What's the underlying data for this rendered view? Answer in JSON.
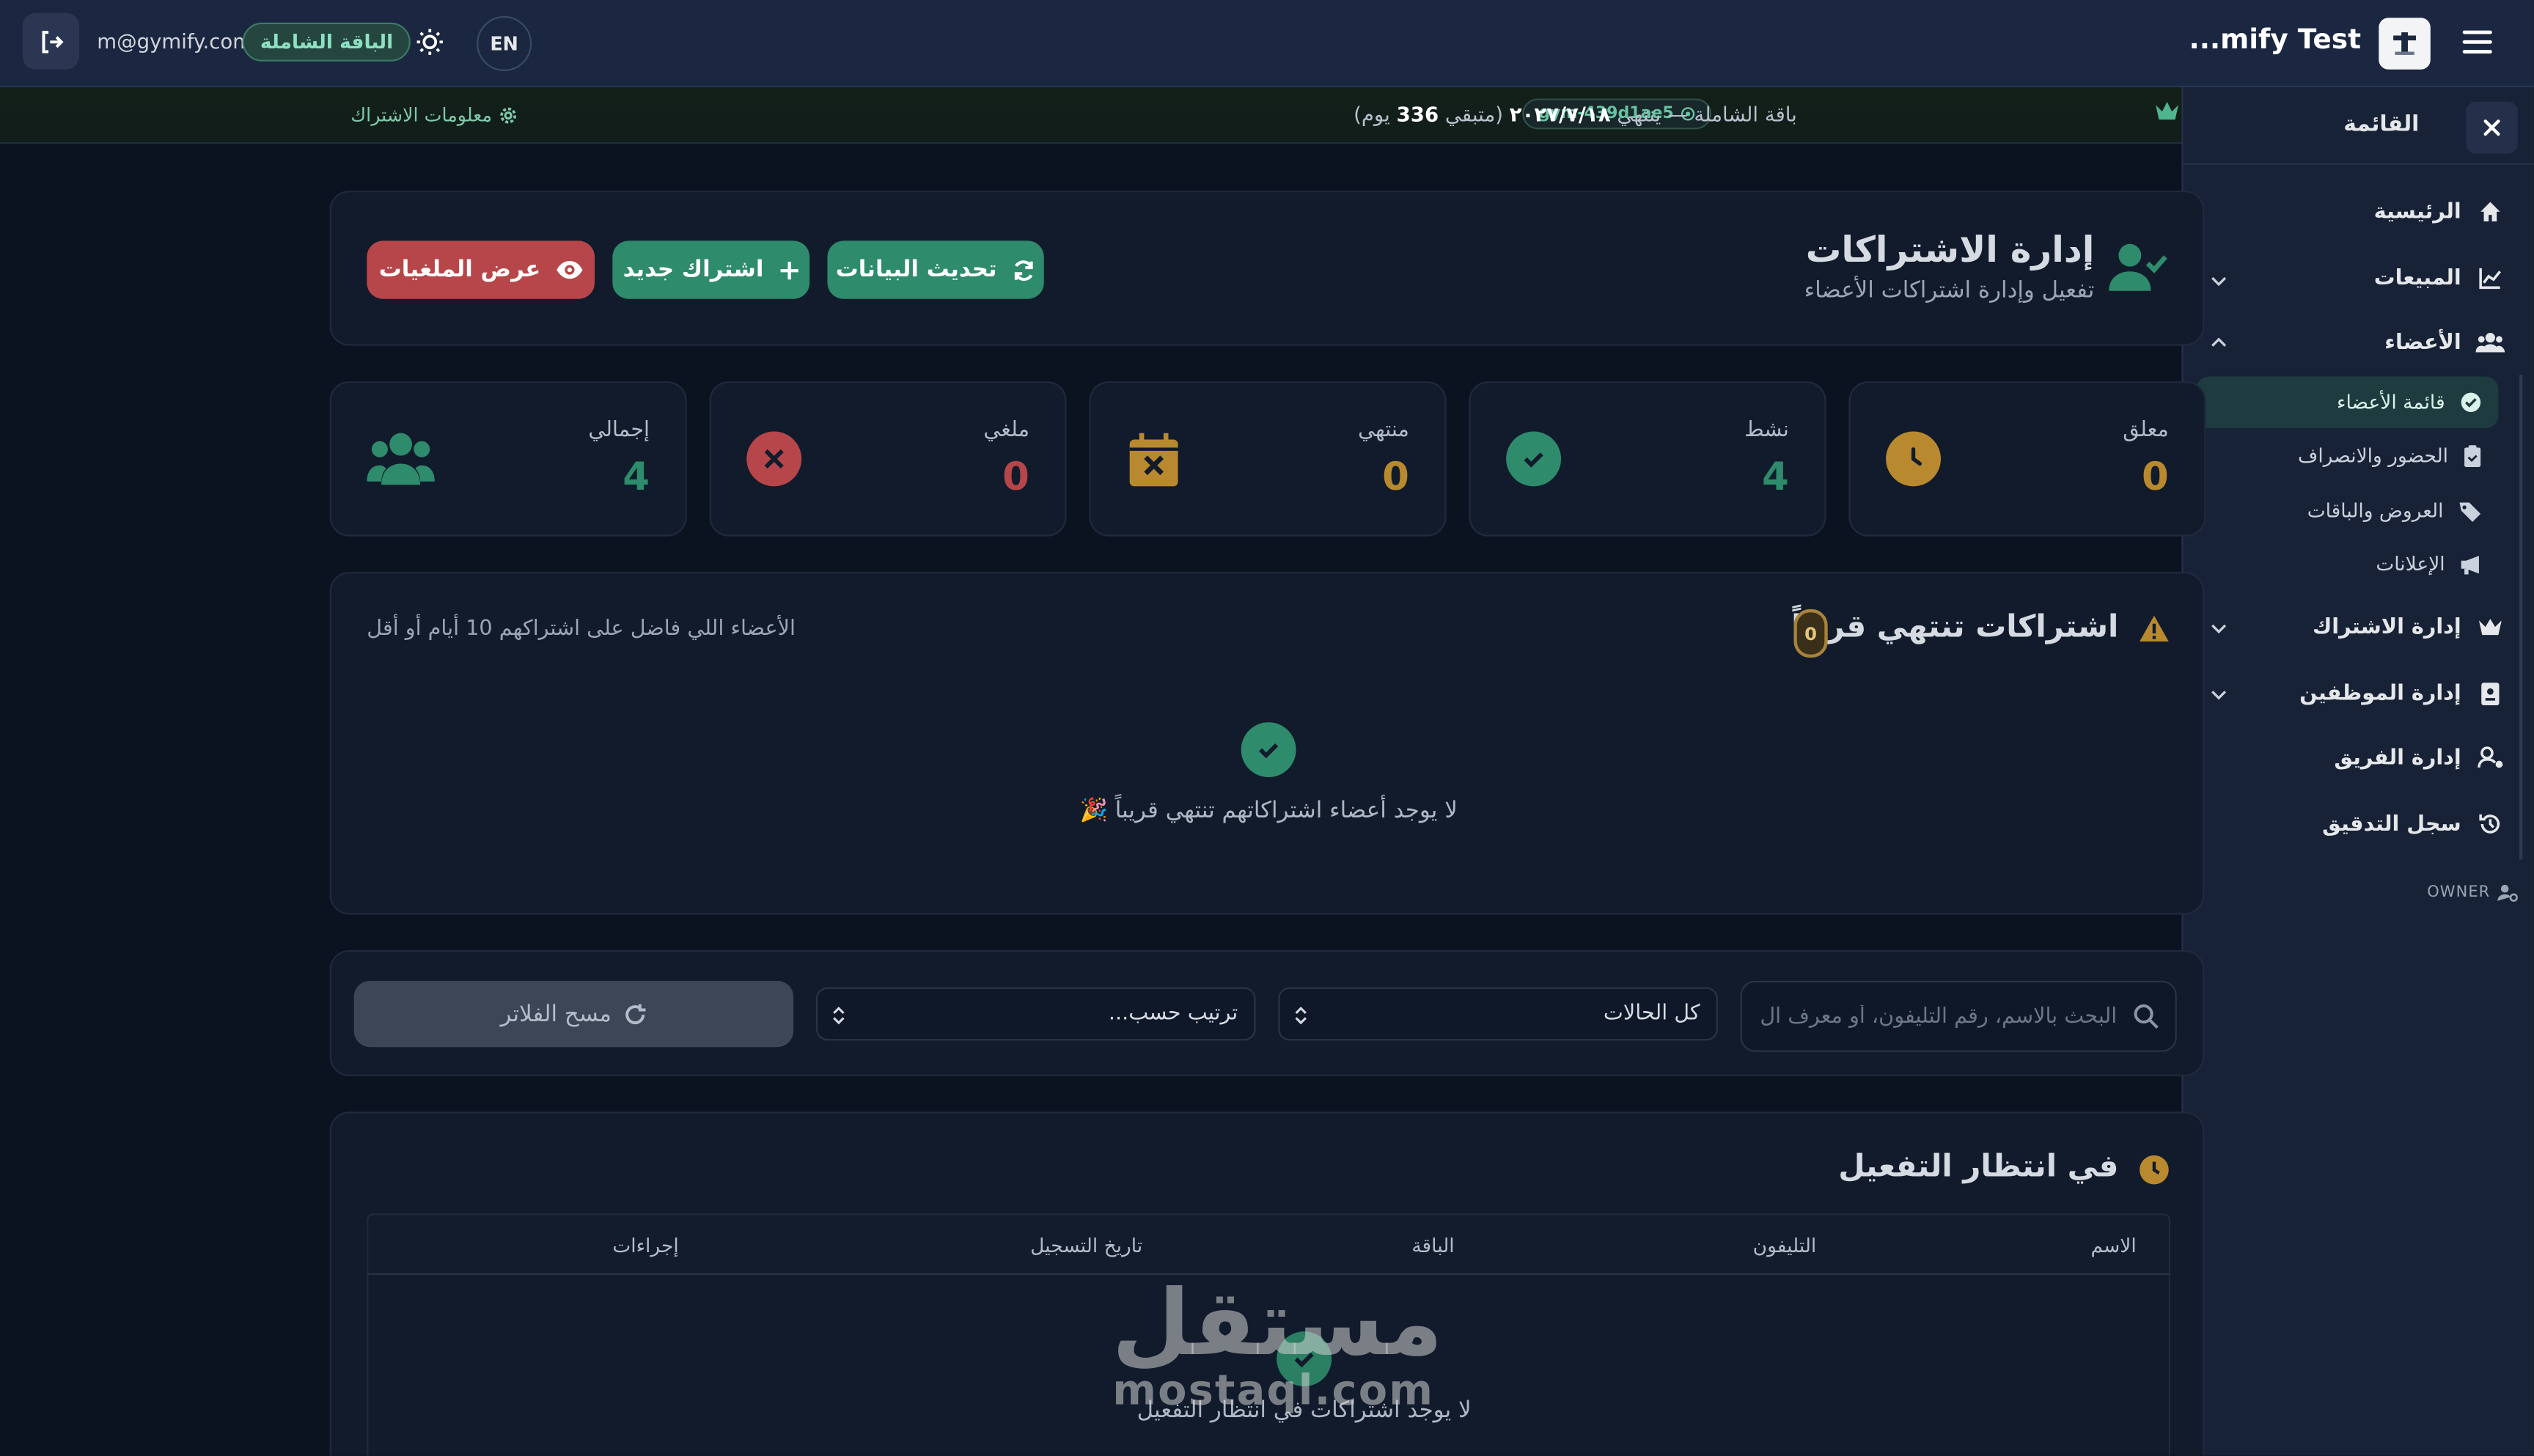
{
  "topbar": {
    "email": "m@gymify.com",
    "plan_badge": "الباقة الشاملة",
    "lang": "EN",
    "brand_name": "...mify Test"
  },
  "subbar": {
    "sub_info_label": "معلومات الاشتراك",
    "gym_code": "gym-439d1ae5",
    "plan_prefix": "باقة الشاملة — ينتهي",
    "plan_date": "٢٠٢٧/٧/١٨",
    "remaining_prefix": "(متبقي",
    "remaining_days": "336",
    "remaining_suffix": "يوم)"
  },
  "sidebar": {
    "title": "القائمة",
    "items": [
      {
        "label": "الرئيسية",
        "icon": "home-icon"
      },
      {
        "label": "المبيعات",
        "icon": "chart-line-icon"
      },
      {
        "label": "الأعضاء",
        "icon": "users-icon"
      },
      {
        "label": "إدارة الاشتراك",
        "icon": "crown-icon"
      },
      {
        "label": "إدارة الموظفين",
        "icon": "id-card-icon"
      },
      {
        "label": "إدارة الفريق",
        "icon": "user-gear-icon"
      },
      {
        "label": "سجل التدقيق",
        "icon": "history-icon"
      }
    ],
    "members_sub": [
      {
        "label": "قائمة الأعضاء",
        "icon": "check-circle-icon"
      },
      {
        "label": "الحضور والانصراف",
        "icon": "clipboard-icon"
      },
      {
        "label": "العروض والباقات",
        "icon": "tags-icon"
      },
      {
        "label": "الإعلانات",
        "icon": "megaphone-icon"
      }
    ],
    "owner": "OWNER"
  },
  "header": {
    "title": "إدارة الاشتراكات",
    "subtitle": "تفعيل وإدارة اشتراكات الأعضاء",
    "btn_refresh": "تحديث البيانات",
    "btn_new": "اشتراك جديد",
    "btn_cancelled": "عرض الملغيات"
  },
  "stats": [
    {
      "label": "معلق",
      "value": "0",
      "color": "#b8892e"
    },
    {
      "label": "نشط",
      "value": "4",
      "color": "#2e8b6b"
    },
    {
      "label": "منتهي",
      "value": "0",
      "color": "#b8892e"
    },
    {
      "label": "ملغي",
      "value": "0",
      "color": "#b6464a"
    },
    {
      "label": "إجمالي",
      "value": "4",
      "color": "#2e8b6b"
    }
  ],
  "expiring": {
    "title": "اشتراكات تنتهي قريباً",
    "count": "0",
    "hint": "الأعضاء اللي فاضل على اشتراكهم 10 أيام أو أقل",
    "empty": "لا يوجد أعضاء اشتراكاتهم تنتهي قريباً 🎉"
  },
  "filters": {
    "search_placeholder": "البحث بالاسم، رقم التليفون، أو معرف ال",
    "status_value": "كل الحالات",
    "sort_value": "ترتيب حسب...",
    "clear_label": "مسح الفلاتر"
  },
  "pending": {
    "title": "في انتظار التفعيل",
    "columns": [
      "الاسم",
      "التليفون",
      "الباقة",
      "تاريخ التسجيل",
      "إجراءات"
    ],
    "empty": "لا يوجد اشتراكات في انتظار التفعيل"
  },
  "watermark": {
    "arabic": "مستقل",
    "latin": "mostaql.com"
  },
  "colors": {
    "accent_green": "#2e8b6b",
    "danger_red": "#b6464a",
    "warning_gold": "#b8892e",
    "sidebar_bg": "#172236",
    "page_bg": "#0c1320"
  }
}
